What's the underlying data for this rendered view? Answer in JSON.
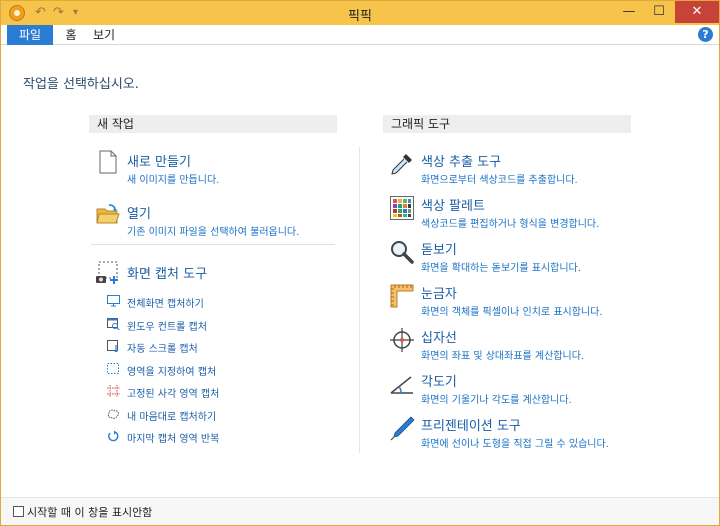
{
  "window": {
    "title": "픽픽",
    "qat": {
      "undo": "↶",
      "redo": "↷",
      "customize": "▾"
    },
    "controls": {
      "minimize": "—",
      "maximize": "☐",
      "close": "✕"
    }
  },
  "menu": {
    "file": "파일",
    "home": "홈",
    "view": "보기",
    "help": "?"
  },
  "prompt": "작업을 선택하십시오.",
  "new_task": {
    "header": "새 작업",
    "items": [
      {
        "title": "새로 만들기",
        "desc": "새 이미지를 만듭니다.",
        "icon": "new-file-icon"
      },
      {
        "title": "열기",
        "desc": "기존 이미지 파일을 선택하여 불러옵니다.",
        "icon": "open-folder-icon"
      }
    ],
    "capture": {
      "title": "화면 캡처 도구",
      "icon": "screen-capture-icon",
      "items": [
        {
          "label": "전체화면 캡처하기",
          "icon": "monitor-icon"
        },
        {
          "label": "윈도우 컨트롤 캡처",
          "icon": "window-control-icon"
        },
        {
          "label": "자동 스크롤 캡처",
          "icon": "scroll-capture-icon"
        },
        {
          "label": "영역을 지정하여 캡처",
          "icon": "region-icon"
        },
        {
          "label": "고정된 사각 영역 캡처",
          "icon": "fixed-region-icon"
        },
        {
          "label": "내 마음대로 캡처하기",
          "icon": "freehand-icon"
        },
        {
          "label": "마지막 캡처 영역 반복",
          "icon": "repeat-icon"
        }
      ]
    }
  },
  "graphic_tools": {
    "header": "그래픽 도구",
    "items": [
      {
        "title": "색상 추출 도구",
        "desc": "화면으로부터 색상코드를 추출합니다.",
        "icon": "eyedropper-icon"
      },
      {
        "title": "색상 팔레트",
        "desc": "색상코드를 편집하거나 형식을 변경합니다.",
        "icon": "palette-icon"
      },
      {
        "title": "돋보기",
        "desc": "화면을 확대하는 돋보기를 표시합니다.",
        "icon": "magnifier-icon"
      },
      {
        "title": "눈금자",
        "desc": "화면의 객체를 픽셀이나 인치로 표시합니다.",
        "icon": "ruler-icon"
      },
      {
        "title": "십자선",
        "desc": "화면의 좌표 및 상대좌표를 계산합니다.",
        "icon": "crosshair-icon"
      },
      {
        "title": "각도기",
        "desc": "화면의 기울기나 각도를 계산합니다.",
        "icon": "protractor-icon"
      },
      {
        "title": "프리젠테이션 도구",
        "desc": "화면에 선이나 도형을 직접 그릴 수 있습니다.",
        "icon": "pen-icon"
      }
    ]
  },
  "footer": {
    "checkbox_label": "시작할 때 이 창을 표시안함"
  },
  "colors": {
    "accent": "#2b7cd3",
    "title_bar": "#f6c44a",
    "link": "#1a5ea8"
  }
}
